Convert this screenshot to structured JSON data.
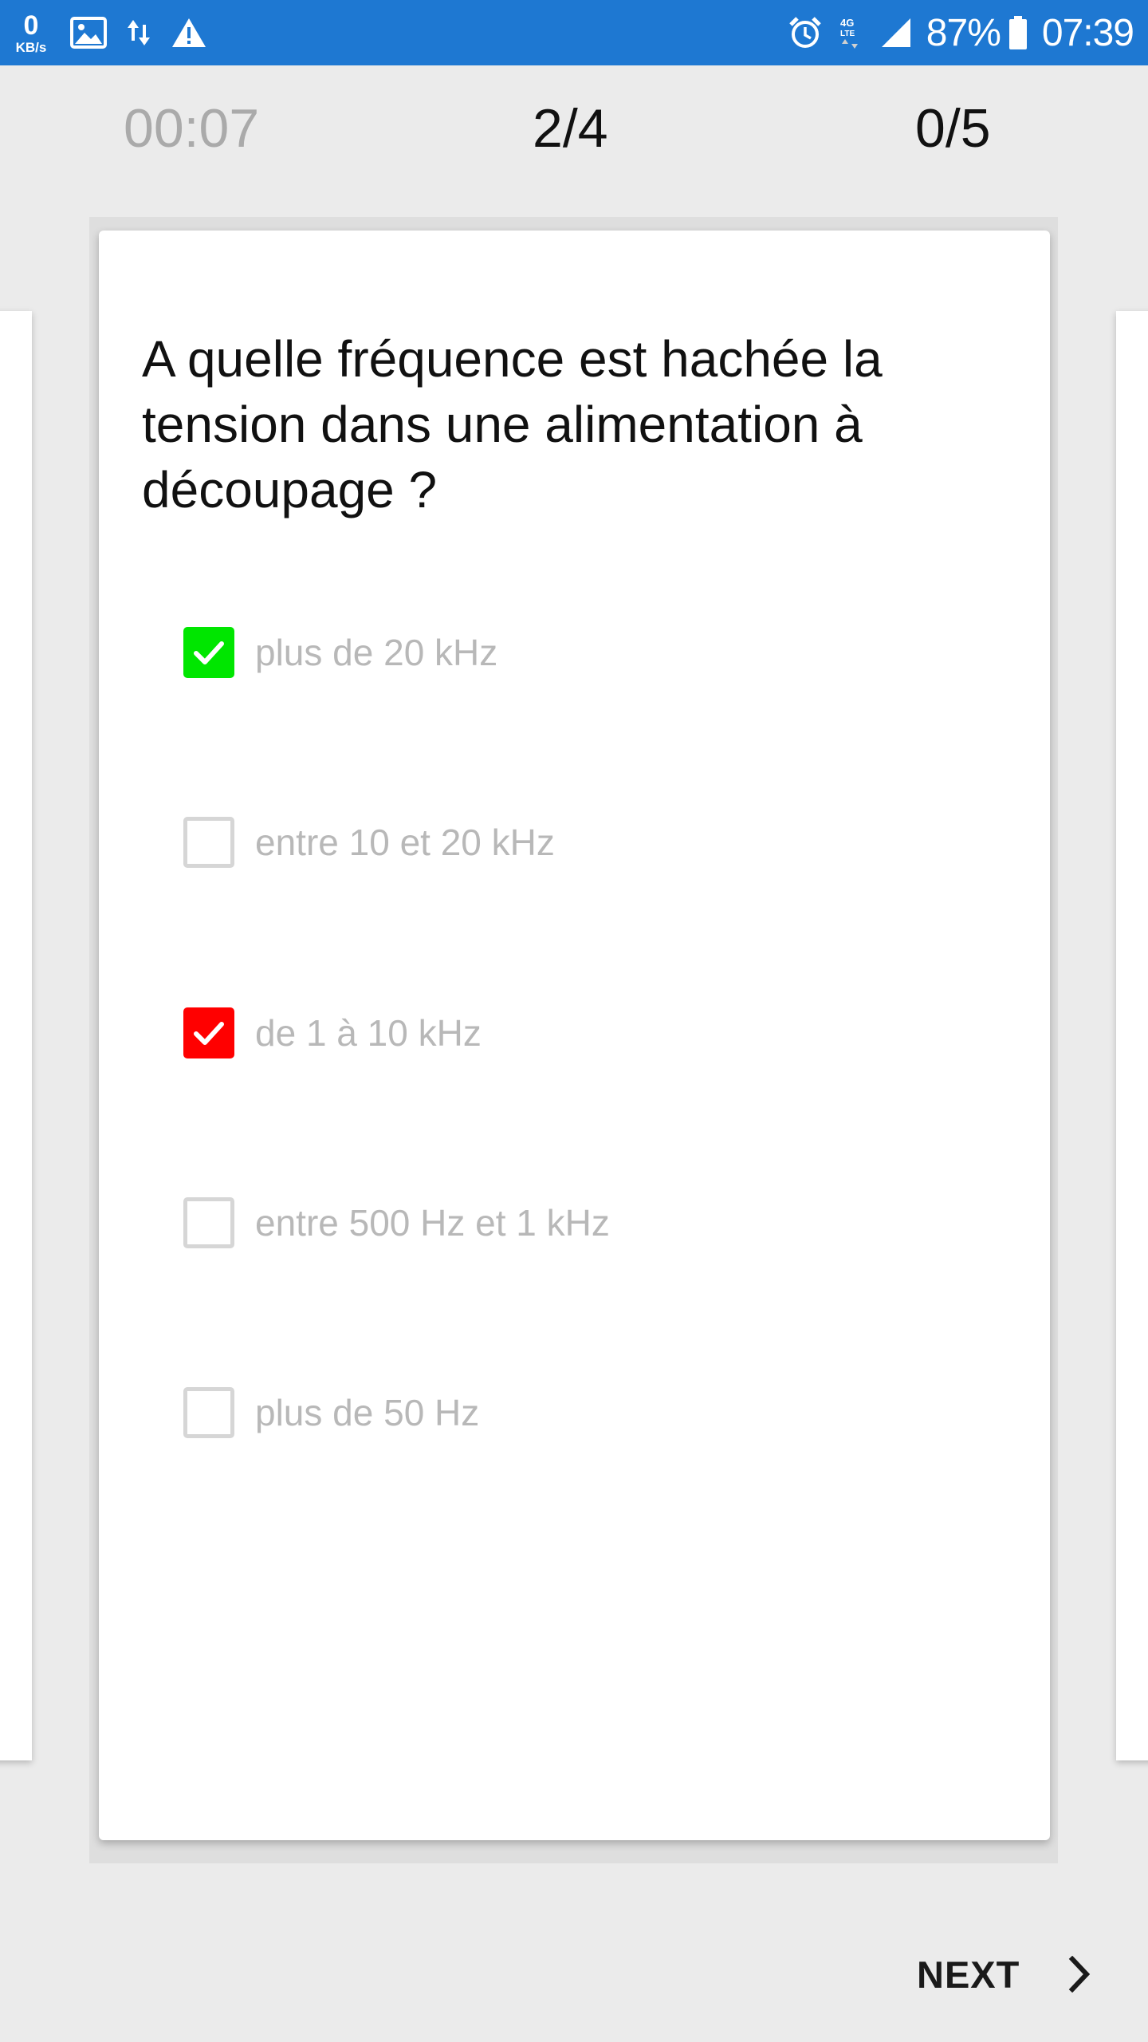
{
  "status_bar": {
    "net_speed_value": "0",
    "net_speed_unit": "KB/s",
    "battery": "87%",
    "time": "07:39",
    "background": "#1e78d2",
    "icons_left": [
      "image-icon",
      "data-transfer-icon",
      "warning-icon"
    ],
    "icons_right": [
      "alarm-icon",
      "4g-lte-icon",
      "signal-icon",
      "battery-icon"
    ]
  },
  "quiz": {
    "timer": "00:07",
    "progress": "2/4",
    "score": "0/5",
    "question": "A quelle fréquence est hachée la tension dans une alimentation à découpage ?",
    "options": [
      {
        "label": "plus de 20 kHz",
        "checked": true,
        "state": "correct",
        "color": "#00e600"
      },
      {
        "label": "entre 10 et 20 kHz",
        "checked": false,
        "state": "none"
      },
      {
        "label": "de 1 à 10 kHz",
        "checked": true,
        "state": "wrong",
        "color": "#ff0000"
      },
      {
        "label": "entre 500 Hz et 1 kHz",
        "checked": false,
        "state": "none"
      },
      {
        "label": "plus de 50 Hz",
        "checked": false,
        "state": "none"
      }
    ]
  },
  "nav": {
    "next_label": "NEXT",
    "next_icon": "chevron-right-icon"
  }
}
